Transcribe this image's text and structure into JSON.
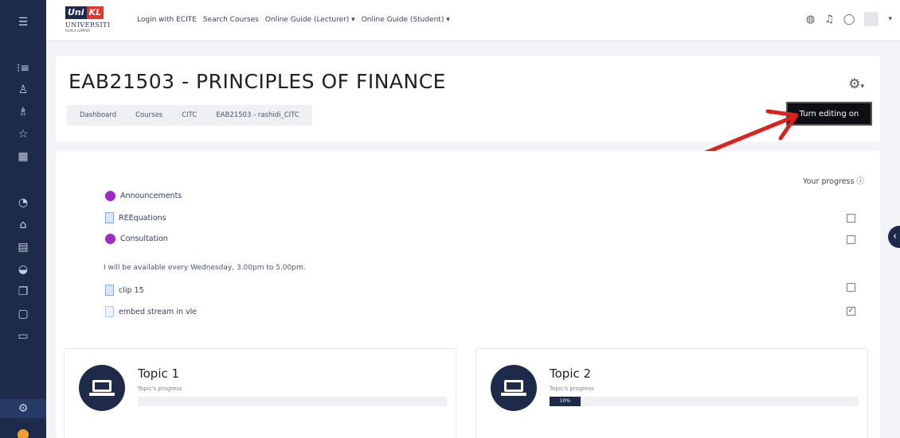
{
  "sidebar": {
    "icons": [
      "menu-icon",
      "list-icon",
      "user-icon",
      "users-icon",
      "star-icon",
      "grid-icon",
      "dashboard-icon",
      "home-icon",
      "calendar-icon",
      "graduation-icon",
      "files-icon",
      "clipboard-icon",
      "folder-icon",
      "gear-icon"
    ]
  },
  "topbar": {
    "logo": {
      "uni": "Uni",
      "kl": "KL",
      "univ": "UNIVERSITI",
      "city": "KUALA LUMPUR"
    },
    "nav": [
      "Login with ECITE",
      "Search Courses",
      "Online Guide (Lecturer) ▾",
      "Online Guide (Student) ▾"
    ]
  },
  "course": {
    "title": "EAB21503 - PRINCIPLES OF FINANCE",
    "breadcrumb": [
      "Dashboard",
      "Courses",
      "CITC",
      "EAB21503 - rashidi_CITC"
    ],
    "edit_button": "Turn editing on"
  },
  "content": {
    "progress_label": "Your progress",
    "activities": [
      {
        "name": "Announcements",
        "icon": "purple"
      },
      {
        "name": "REEquations",
        "icon": "file"
      },
      {
        "name": "Consultation",
        "icon": "purple"
      },
      {
        "name": "clip 15",
        "icon": "file"
      },
      {
        "name": "embed stream in vle",
        "icon": "page"
      }
    ],
    "description": "I will be available every Wednesday, 3.00pm to 5.00pm.",
    "checks": [
      false,
      false,
      false,
      true
    ]
  },
  "topics": [
    {
      "name": "Topic 1",
      "progress_label": "Topic's progress",
      "progress_text": "",
      "progress": 0
    },
    {
      "name": "Topic 2",
      "progress_label": "Topic's progress",
      "progress_text": "10%",
      "progress": 10
    }
  ],
  "colors": {
    "sidebar": "#1e2a4a",
    "accent_purple": "#9b2cc4",
    "annotation_red": "#d9231d"
  }
}
